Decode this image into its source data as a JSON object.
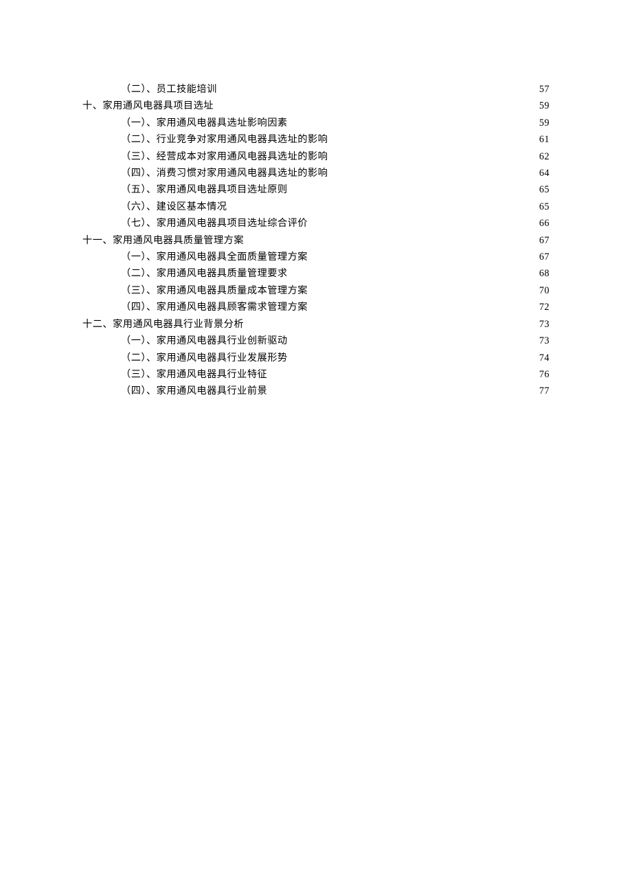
{
  "toc": [
    {
      "level": 2,
      "label": "（二）、员工技能培训",
      "page": "57"
    },
    {
      "level": 1,
      "label": "十、家用通风电器具项目选址",
      "page": "59"
    },
    {
      "level": 2,
      "label": "（一）、家用通风电器具选址影响因素",
      "page": "59"
    },
    {
      "level": 2,
      "label": "（二）、行业竞争对家用通风电器具选址的影响",
      "page": "61"
    },
    {
      "level": 2,
      "label": "（三）、经营成本对家用通风电器具选址的影响",
      "page": "62"
    },
    {
      "level": 2,
      "label": "（四）、消费习惯对家用通风电器具选址的影响",
      "page": "64"
    },
    {
      "level": 2,
      "label": "（五）、家用通风电器具项目选址原则",
      "page": "65"
    },
    {
      "level": 2,
      "label": "（六）、建设区基本情况",
      "page": "65"
    },
    {
      "level": 2,
      "label": "（七）、家用通风电器具项目选址综合评价",
      "page": "66"
    },
    {
      "level": 1,
      "label": "十一、家用通风电器具质量管理方案",
      "page": "67"
    },
    {
      "level": 2,
      "label": "（一）、家用通风电器具全面质量管理方案",
      "page": "67"
    },
    {
      "level": 2,
      "label": "（二）、家用通风电器具质量管理要求",
      "page": "68"
    },
    {
      "level": 2,
      "label": "（三）、家用通风电器具质量成本管理方案",
      "page": "70"
    },
    {
      "level": 2,
      "label": "（四）、家用通风电器具顾客需求管理方案",
      "page": "72"
    },
    {
      "level": 1,
      "label": "十二、家用通风电器具行业背景分析",
      "page": "73"
    },
    {
      "level": 2,
      "label": "（一）、家用通风电器具行业创新驱动",
      "page": "73"
    },
    {
      "level": 2,
      "label": "（二）、家用通风电器具行业发展形势",
      "page": "74"
    },
    {
      "level": 2,
      "label": "（三）、家用通风电器具行业特征",
      "page": "76"
    },
    {
      "level": 2,
      "label": "（四）、家用通风电器具行业前景",
      "page": "77"
    }
  ]
}
